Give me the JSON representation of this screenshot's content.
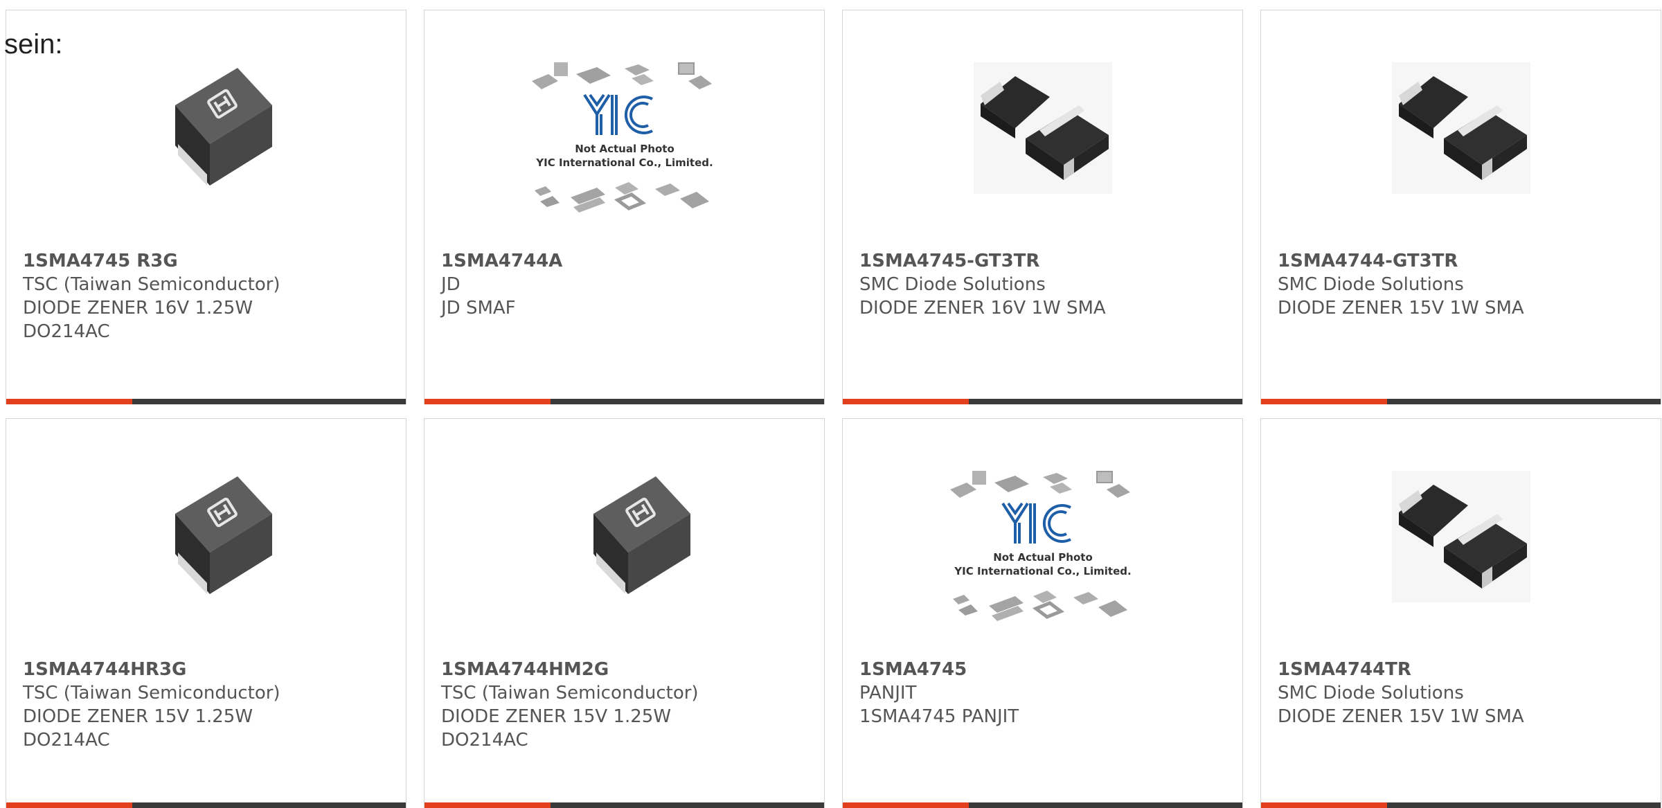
{
  "intro_text": "sein:",
  "colors": {
    "accent": "#e2401c",
    "bar": "#3a3a3a",
    "text": "#555555",
    "border": "#d4d4d4"
  },
  "cards": [
    {
      "name": "1SMA4745 R3G",
      "manufacturer": "TSC (Taiwan Semiconductor)",
      "description": "DIODE ZENER 16V 1.25W",
      "extra": "DO214AC",
      "image": "tsc-smd-diode-icon"
    },
    {
      "name": "1SMA4744A",
      "manufacturer": "JD",
      "description": "JD SMAF",
      "extra": "",
      "image": "yic-placeholder-icon",
      "placeholder_line1": "Not Actual Photo",
      "placeholder_line2": "YIC International Co., Limited."
    },
    {
      "name": "1SMA4745-GT3TR",
      "manufacturer": "SMC Diode Solutions",
      "description": "DIODE ZENER 16V 1W SMA",
      "extra": "",
      "image": "sma-diode-pair-icon"
    },
    {
      "name": "1SMA4744-GT3TR",
      "manufacturer": "SMC Diode Solutions",
      "description": "DIODE ZENER 15V 1W SMA",
      "extra": "",
      "image": "sma-diode-pair-icon"
    },
    {
      "name": "1SMA4744HR3G",
      "manufacturer": "TSC (Taiwan Semiconductor)",
      "description": "DIODE ZENER 15V 1.25W",
      "extra": "DO214AC",
      "image": "tsc-smd-diode-icon"
    },
    {
      "name": "1SMA4744HM2G",
      "manufacturer": "TSC (Taiwan Semiconductor)",
      "description": "DIODE ZENER 15V 1.25W",
      "extra": "DO214AC",
      "image": "tsc-smd-diode-icon"
    },
    {
      "name": "1SMA4745",
      "manufacturer": "PANJIT",
      "description": "1SMA4745 PANJIT",
      "extra": "",
      "image": "yic-placeholder-icon",
      "placeholder_line1": "Not Actual Photo",
      "placeholder_line2": "YIC International Co., Limited."
    },
    {
      "name": "1SMA4744TR",
      "manufacturer": "SMC Diode Solutions",
      "description": "DIODE ZENER 15V 1W SMA",
      "extra": "",
      "image": "sma-diode-pair-icon"
    }
  ]
}
